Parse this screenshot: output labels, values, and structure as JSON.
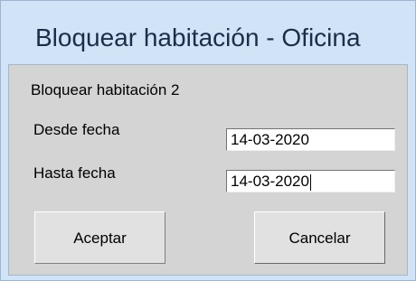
{
  "window": {
    "title": "Bloquear habitación - Oficina"
  },
  "dialog": {
    "room_label": "Bloquear habitación 2",
    "from_label": "Desde fecha",
    "from_value": "14-03-2020",
    "to_label": "Hasta fecha",
    "to_value": "14-03-2020",
    "accept_label": "Aceptar",
    "cancel_label": "Cancelar"
  },
  "colors": {
    "frame": "#d1e3f6",
    "client": "#d4d4d4",
    "button": "#e1e1e1",
    "input": "#ffffff"
  }
}
